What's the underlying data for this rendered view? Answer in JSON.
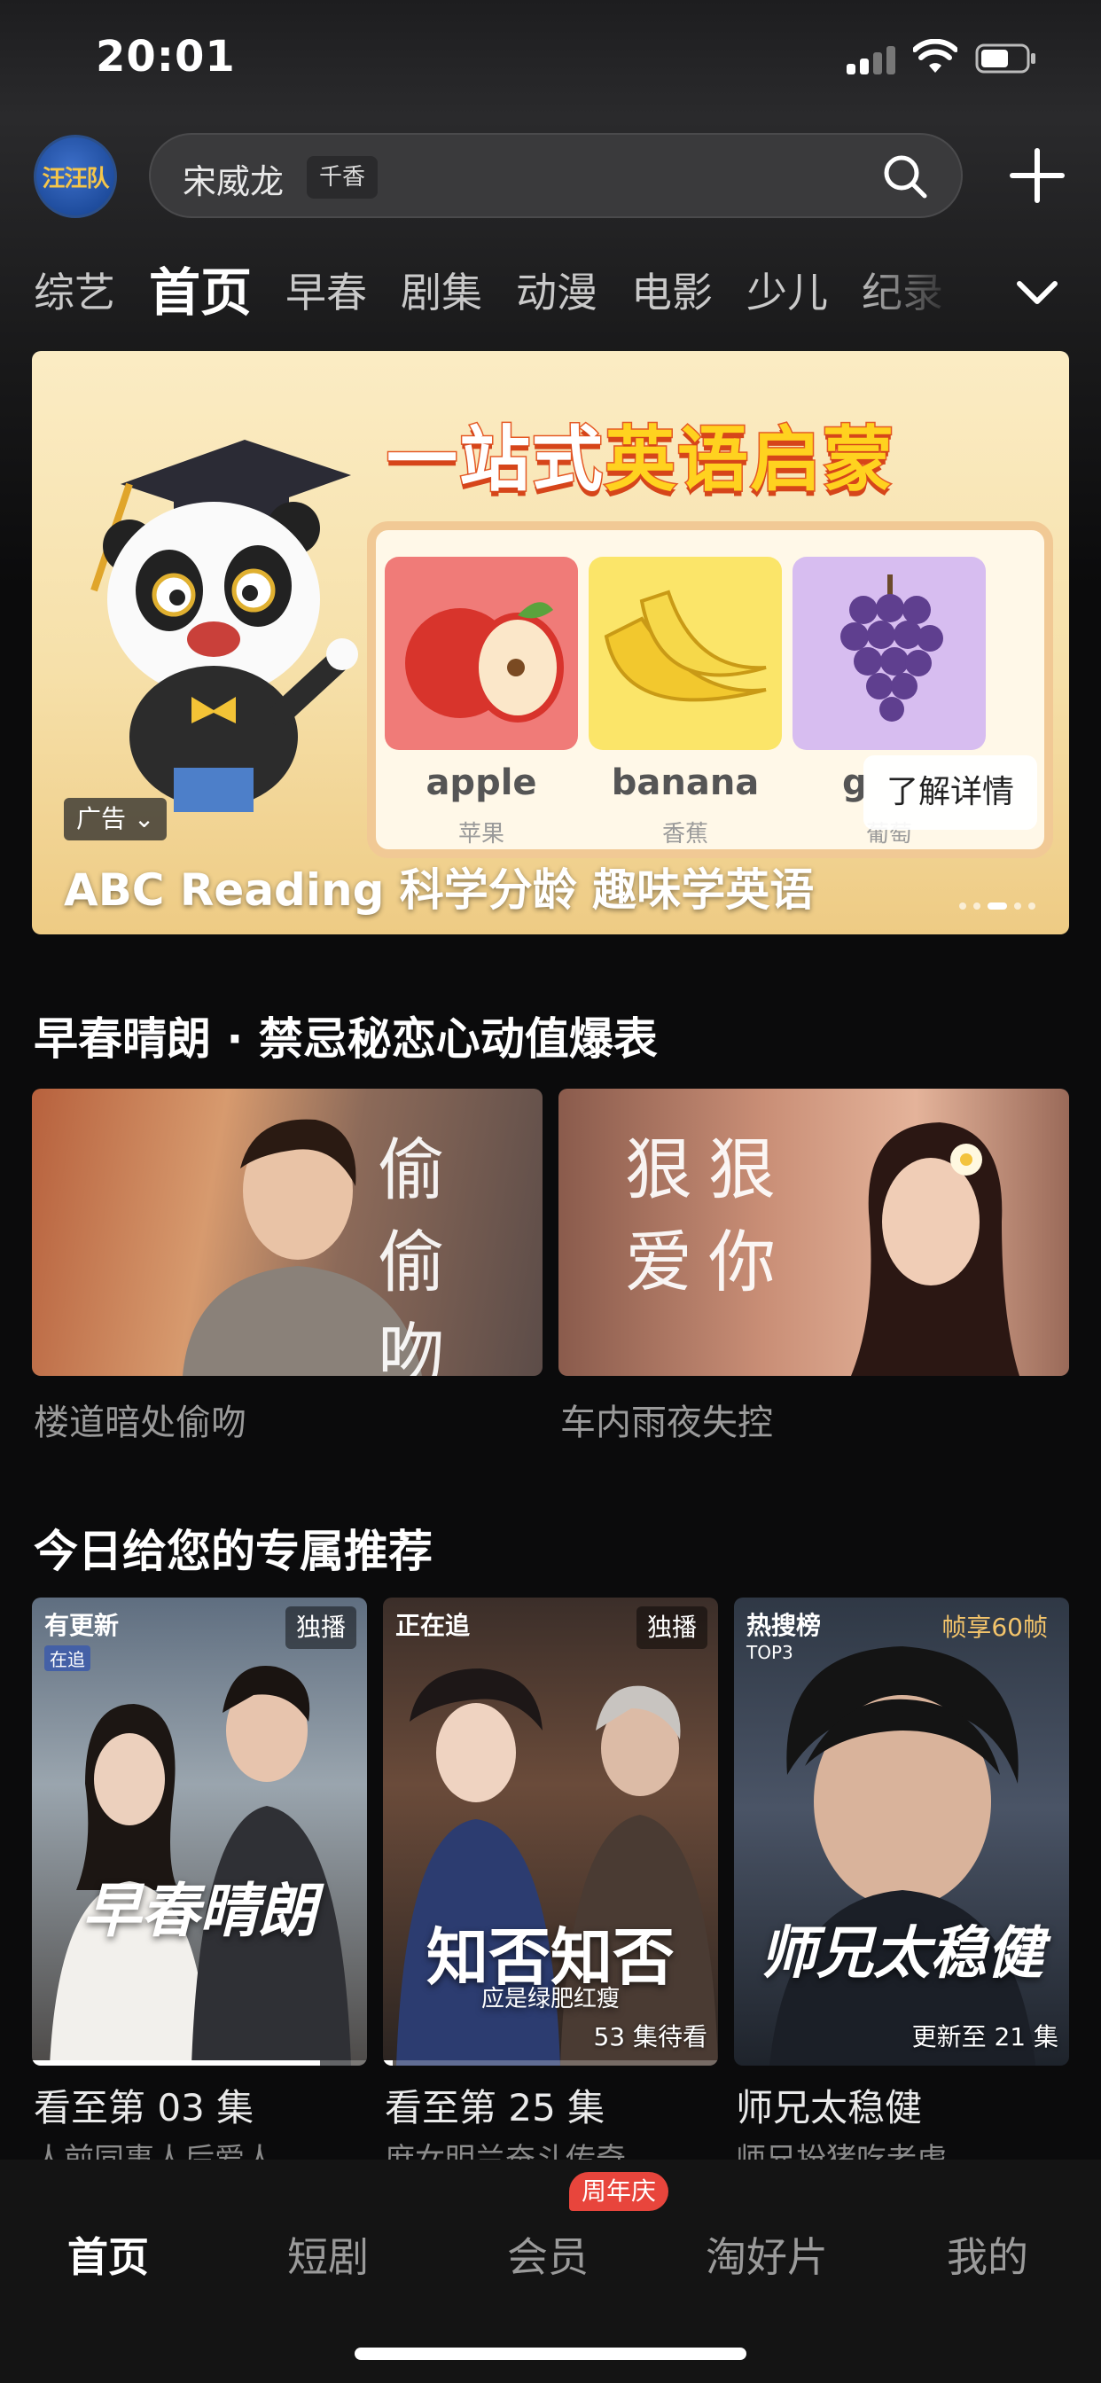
{
  "status_bar": {
    "time": "20:01"
  },
  "header": {
    "avatar_text": "汪汪队",
    "search_query": "宋威龙",
    "search_tag": "千香"
  },
  "tabs": [
    "综艺",
    "首页",
    "早春",
    "剧集",
    "动漫",
    "电影",
    "少儿",
    "纪录"
  ],
  "active_tab": "首页",
  "banner": {
    "headline_part1": "一站式",
    "headline_part2": "英语启蒙",
    "cards": [
      {
        "word": "apple",
        "cn": "苹果"
      },
      {
        "word": "banana",
        "cn": "香蕉"
      },
      {
        "word": "g",
        "cn": "葡萄"
      }
    ],
    "ad_badge": "广告",
    "cta": "了解详情",
    "caption": "ABC Reading 科学分龄 趣味学英语"
  },
  "section1": {
    "title": "早春晴朗 · 禁忌秘恋心动值爆表",
    "items": [
      {
        "overlay_line1": "偷偷",
        "overlay_line2": "吻你",
        "caption": "楼道暗处偷吻"
      },
      {
        "overlay_line1": "狠狠",
        "overlay_line2": "爱你",
        "caption": "车内雨夜失控"
      }
    ]
  },
  "section2": {
    "title": "今日给您的专属推荐",
    "items": [
      {
        "badge_left": "有更新",
        "badge_left_sub": "在追",
        "badge_right": "独播",
        "poster_title": "早春晴朗",
        "poster_foot": "",
        "progress": 0.86,
        "line1": "看至第 03 集",
        "line2": "人前同事人后爱人"
      },
      {
        "badge_left": "正在追",
        "badge_left_sub": "",
        "badge_right": "独播",
        "poster_title": "知否知否",
        "poster_subtitle": "应是绿肥红瘦",
        "poster_foot": "53 集待看",
        "progress": 0.03,
        "line1": "看至第 25 集",
        "line2": "庶女明兰奋斗传奇"
      },
      {
        "badge_left": "热搜榜",
        "badge_left_sub": "TOP3",
        "badge_right": "帧享60帧",
        "poster_title": "师兄太稳健",
        "poster_foot": "更新至 21 集",
        "line1": "师兄太稳健",
        "line2": "师兄扮猪吃老虎"
      }
    ]
  },
  "bottom_nav": {
    "items": [
      "首页",
      "短剧",
      "会员",
      "淘好片",
      "我的"
    ],
    "active": "首页",
    "member_badge": "周年庆"
  }
}
